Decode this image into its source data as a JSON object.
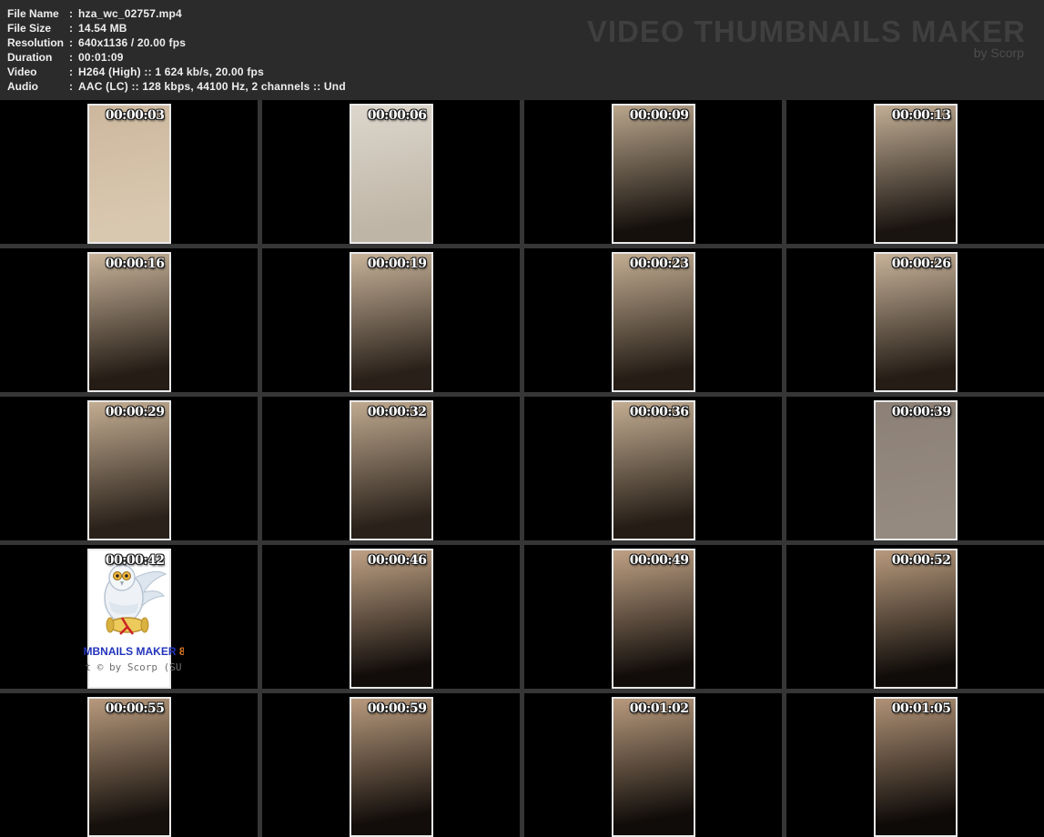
{
  "header": {
    "separator": ":",
    "fields": [
      {
        "label": "File Name",
        "value": "hza_wc_02757.mp4"
      },
      {
        "label": "File Size",
        "value": "14.54 MB"
      },
      {
        "label": "Resolution",
        "value": "640x1136 / 20.00 fps"
      },
      {
        "label": "Duration",
        "value": "00:01:09"
      },
      {
        "label": "Video",
        "value": "H264 (High) :: 1 624 kb/s, 20.00 fps"
      },
      {
        "label": "Audio",
        "value": "AAC (LC) :: 128 kbps, 44100 Hz, 2 channels :: Und"
      }
    ],
    "app_title": "VIDEO THUMBNAILS MAKER",
    "app_subtitle": "by Scorp"
  },
  "colors": {
    "header_bg": "#2b2b2b",
    "header_text": "#eeeeee",
    "logo_text": "#3f3f3f",
    "logo_subtitle": "#4d4d4d",
    "grid_line": "#363636",
    "canvas_bg": "#000000",
    "thumb_border": "#e9e9e9",
    "timestamp": "#ffffff",
    "wm_blue": "#2233bb",
    "wm_orange": "#dd7722",
    "wm_gray": "#707070"
  },
  "grid": {
    "columns": 4,
    "rows": 5,
    "frames": [
      {
        "timestamp": "00:00:03",
        "kind": "frame",
        "tone_top": "#cdb89e",
        "tone_bottom": "#d9c8b0"
      },
      {
        "timestamp": "00:00:06",
        "kind": "frame",
        "tone_top": "#dcd6cc",
        "tone_bottom": "#bfb5a6"
      },
      {
        "timestamp": "00:00:09",
        "kind": "frame",
        "tone_top": "#baa68c",
        "tone_bottom": "#15100c"
      },
      {
        "timestamp": "00:00:13",
        "kind": "frame",
        "tone_top": "#c2ae95",
        "tone_bottom": "#1a1410"
      },
      {
        "timestamp": "00:00:16",
        "kind": "frame",
        "tone_top": "#c8b39a",
        "tone_bottom": "#241c15"
      },
      {
        "timestamp": "00:00:19",
        "kind": "frame",
        "tone_top": "#c8b39a",
        "tone_bottom": "#292019"
      },
      {
        "timestamp": "00:00:23",
        "kind": "frame",
        "tone_top": "#c3ad92",
        "tone_bottom": "#241c15"
      },
      {
        "timestamp": "00:00:26",
        "kind": "frame",
        "tone_top": "#c8b39a",
        "tone_bottom": "#241c15"
      },
      {
        "timestamp": "00:00:29",
        "kind": "frame",
        "tone_top": "#c3ad92",
        "tone_bottom": "#2a211a"
      },
      {
        "timestamp": "00:00:32",
        "kind": "frame",
        "tone_top": "#bfa98f",
        "tone_bottom": "#2a211a"
      },
      {
        "timestamp": "00:00:36",
        "kind": "frame",
        "tone_top": "#c3ad92",
        "tone_bottom": "#241c15"
      },
      {
        "timestamp": "00:00:39",
        "kind": "frame",
        "tone_top": "#8d8177",
        "tone_bottom": "#958a80"
      },
      {
        "timestamp": "00:00:42",
        "kind": "logo",
        "watermark_text": "MBNAILS MAKER",
        "watermark_suffix": "8",
        "watermark_line2": "t © by Scorp (SU"
      },
      {
        "timestamp": "00:00:46",
        "kind": "frame",
        "tone_top": "#bfa184",
        "tone_bottom": "#120d0a"
      },
      {
        "timestamp": "00:00:49",
        "kind": "frame",
        "tone_top": "#bfa184",
        "tone_bottom": "#120d0a"
      },
      {
        "timestamp": "00:00:52",
        "kind": "frame",
        "tone_top": "#b89a7d",
        "tone_bottom": "#100c09"
      },
      {
        "timestamp": "00:00:55",
        "kind": "frame",
        "tone_top": "#b89a7d",
        "tone_bottom": "#15100c"
      },
      {
        "timestamp": "00:00:59",
        "kind": "frame",
        "tone_top": "#b89a7d",
        "tone_bottom": "#120d0a"
      },
      {
        "timestamp": "00:01:02",
        "kind": "frame",
        "tone_top": "#b89a7d",
        "tone_bottom": "#100c09"
      },
      {
        "timestamp": "00:01:05",
        "kind": "frame",
        "tone_top": "#b09276",
        "tone_bottom": "#0e0a08"
      }
    ]
  }
}
